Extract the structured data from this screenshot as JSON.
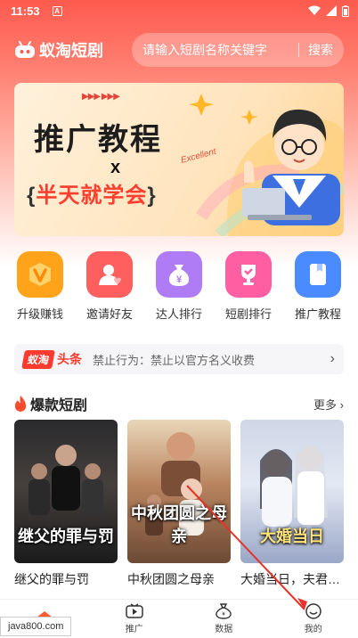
{
  "status_bar": {
    "time": "11:53",
    "a_icon": "A"
  },
  "header": {
    "app_name": "蚁淘短剧",
    "search_placeholder": "请输入短剧名称关键字",
    "search_button": "搜索"
  },
  "banner": {
    "title": "推广教程",
    "x": "x",
    "subtitle_open": "{",
    "subtitle": "半天就学会",
    "subtitle_close": "}",
    "script": "Excellent"
  },
  "menu": [
    {
      "label": "升级赚钱",
      "icon": "upgrade-icon",
      "color": "#ffa31a"
    },
    {
      "label": "邀请好友",
      "icon": "invite-friend-icon",
      "color": "#ff5f5f"
    },
    {
      "label": "达人排行",
      "icon": "money-bag-icon",
      "color": "#b07cf5"
    },
    {
      "label": "短剧排行",
      "icon": "trophy-icon",
      "color": "#ff5fa2"
    },
    {
      "label": "推广教程",
      "icon": "book-icon",
      "color": "#4a8cff"
    }
  ],
  "news": {
    "badge": "蚁淘",
    "label": "头条",
    "text": "禁止行为：禁止以官方名义收费"
  },
  "section": {
    "title": "爆款短剧",
    "more": "更多"
  },
  "dramas": [
    {
      "title": "继父的罪与罚",
      "poster_text": "继父的罪与罚"
    },
    {
      "title": "中秋团圆之母亲",
      "poster_text": "中秋团圆之母亲"
    },
    {
      "title": "大婚当日，夫君…",
      "poster_text": "大婚当日"
    }
  ],
  "tabbar": [
    {
      "label": "",
      "icon": "home-icon"
    },
    {
      "label": "推广",
      "icon": "promote-icon"
    },
    {
      "label": "数据",
      "icon": "data-icon"
    },
    {
      "label": "我的",
      "icon": "profile-icon"
    }
  ],
  "watermark": "java800.com"
}
